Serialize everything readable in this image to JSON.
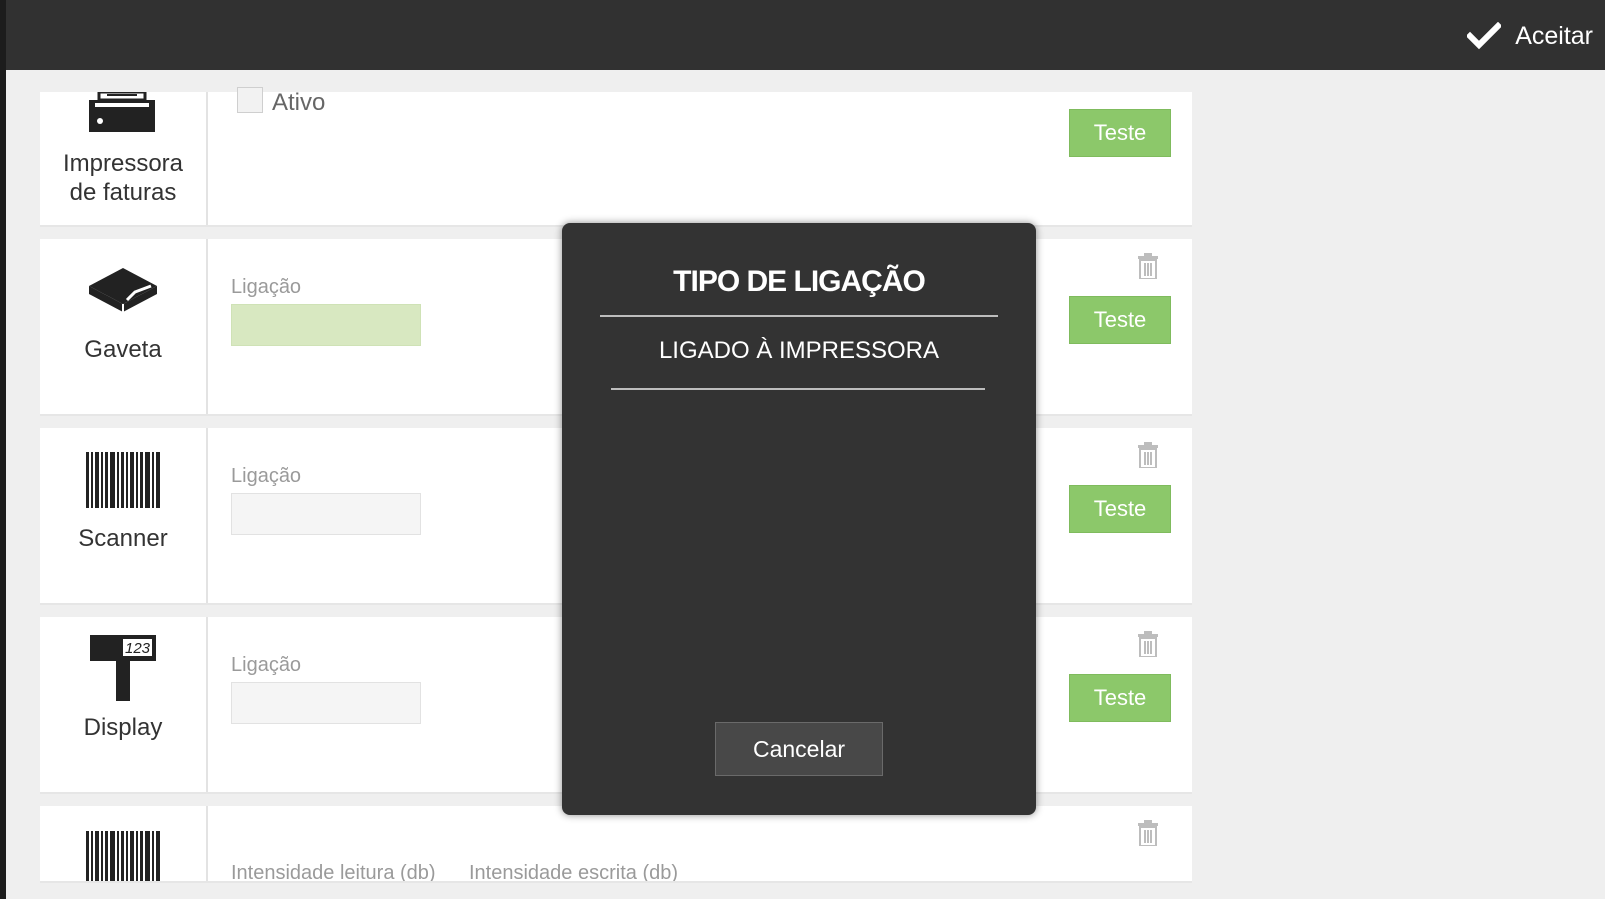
{
  "header": {
    "accept_label": "Aceitar",
    "accept_icon": "checkmark-icon"
  },
  "devices": [
    {
      "label_line1": "Impressora",
      "label_line2": "de faturas",
      "icon": "printer-icon",
      "checkbox_label": "Ativo",
      "test_label": "Teste"
    },
    {
      "label": "Gaveta",
      "icon": "drawer-icon",
      "field_label": "Ligação",
      "field_value": "",
      "test_label": "Teste"
    },
    {
      "label": "Scanner",
      "icon": "barcode-icon",
      "field_label": "Ligação",
      "field_value": "",
      "test_label": "Teste"
    },
    {
      "label": "Display",
      "icon": "customer-display-icon",
      "display_text": "123",
      "field_label": "Ligação",
      "field_value": "",
      "test_label": "Teste"
    },
    {
      "icon": "barcode-icon",
      "field_label_1": "Intensidade leitura (db)",
      "field_label_2": "Intensidade escrita (db)"
    }
  ],
  "modal": {
    "title": "TIPO DE LIGAÇÃO",
    "options": [
      "LIGADO À IMPRESSORA"
    ],
    "cancel_label": "Cancelar"
  },
  "colors": {
    "topbar": "#313131",
    "test_button": "#8cc86a",
    "modal_bg": "#333333",
    "selected_field": "#d8e8c1"
  }
}
